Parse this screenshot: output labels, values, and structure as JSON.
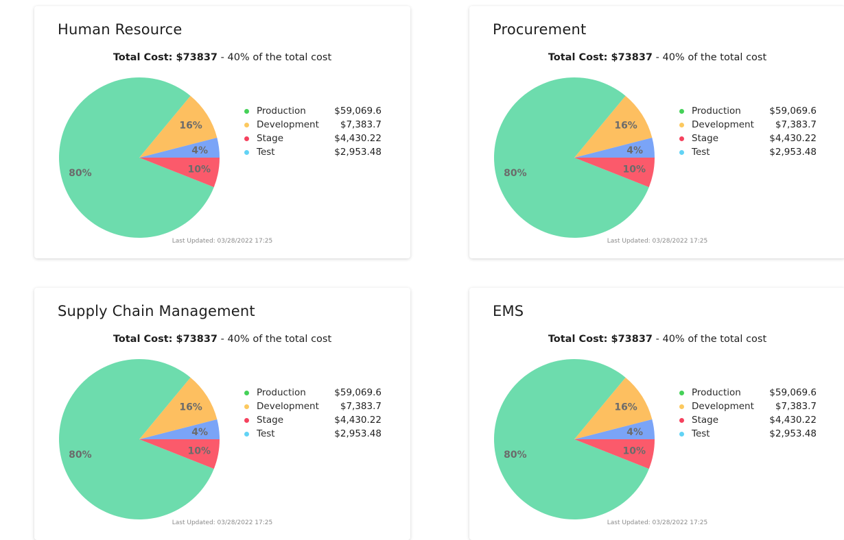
{
  "colors": {
    "production": "#6ddcad",
    "development": "#fdbf60",
    "stage": "#fb5a6b",
    "test": "#7aa4f7",
    "legend_production": "#45d158",
    "legend_development": "#fcc95f",
    "legend_stage": "#f5425e",
    "legend_test": "#62d3f5"
  },
  "cards": [
    {
      "title": "Human Resource",
      "total_label": "Total Cost: $73837",
      "total_suffix": " -  40% of the total cost",
      "updated": "Last Updated: 03/28/2022 17:25"
    },
    {
      "title": "Procurement",
      "total_label": "Total Cost: $73837",
      "total_suffix": " -  40% of the total cost",
      "updated": "Last Updated: 03/28/2022 17:25"
    },
    {
      "title": "Supply Chain Management",
      "total_label": "Total Cost: $73837",
      "total_suffix": " -  40% of the total cost",
      "updated": "Last Updated: 03/28/2022 17:25"
    },
    {
      "title": "EMS",
      "total_label": "Total Cost: $73837",
      "total_suffix": " -  40% of the total cost",
      "updated": "Last Updated: 03/28/2022 17:25"
    }
  ],
  "chart_data": [
    {
      "type": "pie",
      "title": "Human Resource",
      "categories": [
        "Production",
        "Development",
        "Stage",
        "Test"
      ],
      "values": [
        59069.6,
        7383.7,
        4430.22,
        2953.48
      ],
      "value_labels": [
        "$59,069.6",
        "$7,383.7",
        "$4,430.22",
        "$2,953.48"
      ],
      "percent_labels": [
        "80%",
        "16%",
        "10%",
        "4%"
      ],
      "legend": "right"
    },
    {
      "type": "pie",
      "title": "Procurement",
      "categories": [
        "Production",
        "Development",
        "Stage",
        "Test"
      ],
      "values": [
        59069.6,
        7383.7,
        4430.22,
        2953.48
      ],
      "value_labels": [
        "$59,069.6",
        "$7,383.7",
        "$4,430.22",
        "$2,953.48"
      ],
      "percent_labels": [
        "80%",
        "16%",
        "10%",
        "4%"
      ],
      "legend": "right"
    },
    {
      "type": "pie",
      "title": "Supply Chain Management",
      "categories": [
        "Production",
        "Development",
        "Stage",
        "Test"
      ],
      "values": [
        59069.6,
        7383.7,
        4430.22,
        2953.48
      ],
      "value_labels": [
        "$59,069.6",
        "$7,383.7",
        "$4,430.22",
        "$2,953.48"
      ],
      "percent_labels": [
        "80%",
        "16%",
        "10%",
        "4%"
      ],
      "legend": "right"
    },
    {
      "type": "pie",
      "title": "EMS",
      "categories": [
        "Production",
        "Development",
        "Stage",
        "Test"
      ],
      "values": [
        59069.6,
        7383.7,
        4430.22,
        2953.48
      ],
      "value_labels": [
        "$59,069.6",
        "$7,383.7",
        "$4,430.22",
        "$2,953.48"
      ],
      "percent_labels": [
        "80%",
        "16%",
        "10%",
        "4%"
      ],
      "legend": "right"
    }
  ]
}
